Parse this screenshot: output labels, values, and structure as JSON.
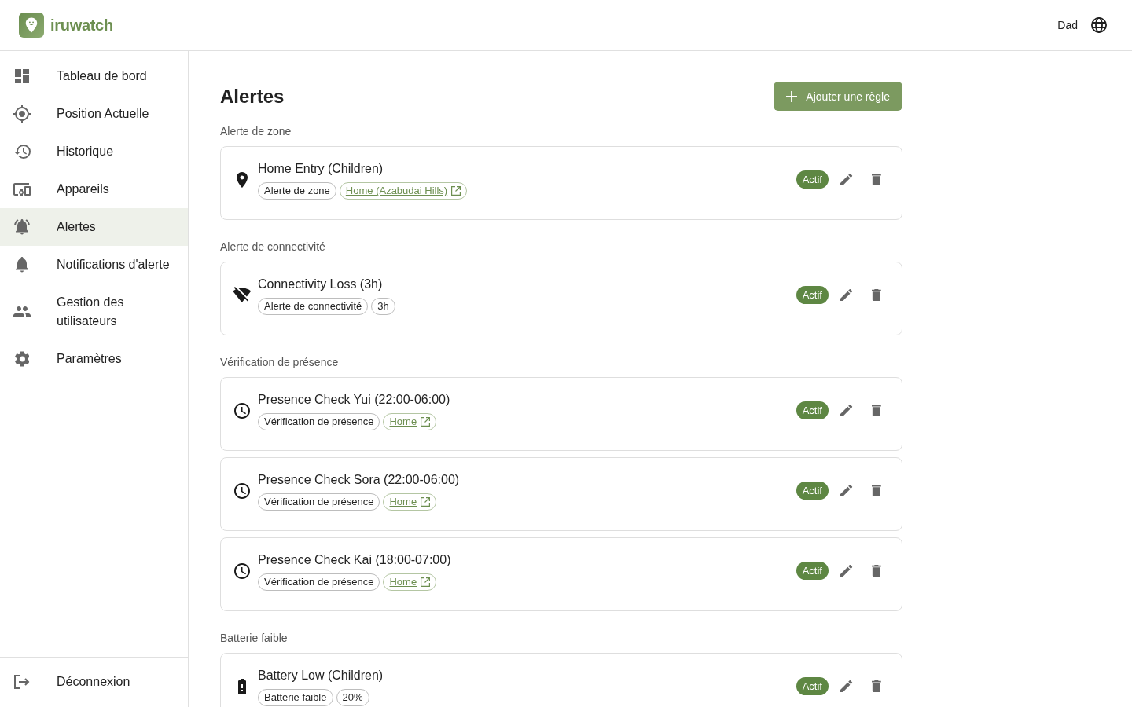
{
  "brand": {
    "name": "iruwatch"
  },
  "header": {
    "user": "Dad"
  },
  "sidebar": {
    "items": [
      {
        "label": "Tableau de bord",
        "selected": false
      },
      {
        "label": "Position Actuelle",
        "selected": false
      },
      {
        "label": "Historique",
        "selected": false
      },
      {
        "label": "Appareils",
        "selected": false
      },
      {
        "label": "Alertes",
        "selected": true
      },
      {
        "label": "Notifications d'alerte",
        "selected": false
      },
      {
        "label": "Gestion des utilisateurs",
        "selected": false
      },
      {
        "label": "Paramètres",
        "selected": false
      }
    ],
    "logout": "Déconnexion"
  },
  "page": {
    "title": "Alertes",
    "add_button": "Ajouter une règle"
  },
  "sections": [
    {
      "title": "Alerte de zone",
      "rules": [
        {
          "kind": "zone",
          "name": "Home Entry (Children)",
          "tags": [
            {
              "kind": "label",
              "text": "Alerte de zone"
            },
            {
              "kind": "link",
              "text": "Home (Azabudai Hills)"
            }
          ],
          "status": "Actif",
          "active": true
        }
      ]
    },
    {
      "title": "Alerte de connectivité",
      "rules": [
        {
          "kind": "connectivity",
          "name": "Connectivity Loss (3h)",
          "tags": [
            {
              "kind": "label",
              "text": "Alerte de connectivité"
            },
            {
              "kind": "label",
              "text": "3h"
            }
          ],
          "status": "Actif",
          "active": true
        }
      ]
    },
    {
      "title": "Vérification de présence",
      "rules": [
        {
          "kind": "presence",
          "name": "Presence Check Yui (22:00-06:00)",
          "tags": [
            {
              "kind": "label",
              "text": "Vérification de présence"
            },
            {
              "kind": "link",
              "text": "Home"
            }
          ],
          "status": "Actif",
          "active": true
        },
        {
          "kind": "presence",
          "name": "Presence Check Sora (22:00-06:00)",
          "tags": [
            {
              "kind": "label",
              "text": "Vérification de présence"
            },
            {
              "kind": "link",
              "text": "Home"
            }
          ],
          "status": "Actif",
          "active": true
        },
        {
          "kind": "presence",
          "name": "Presence Check Kai (18:00-07:00)",
          "tags": [
            {
              "kind": "label",
              "text": "Vérification de présence"
            },
            {
              "kind": "link",
              "text": "Home"
            }
          ],
          "status": "Actif",
          "active": true
        }
      ]
    },
    {
      "title": "Batterie faible",
      "rules": [
        {
          "kind": "battery",
          "name": "Battery Low (Children)",
          "tags": [
            {
              "kind": "label",
              "text": "Batterie faible"
            },
            {
              "kind": "label",
              "text": "20%"
            }
          ],
          "status": "Actif",
          "active": true
        }
      ]
    }
  ]
}
